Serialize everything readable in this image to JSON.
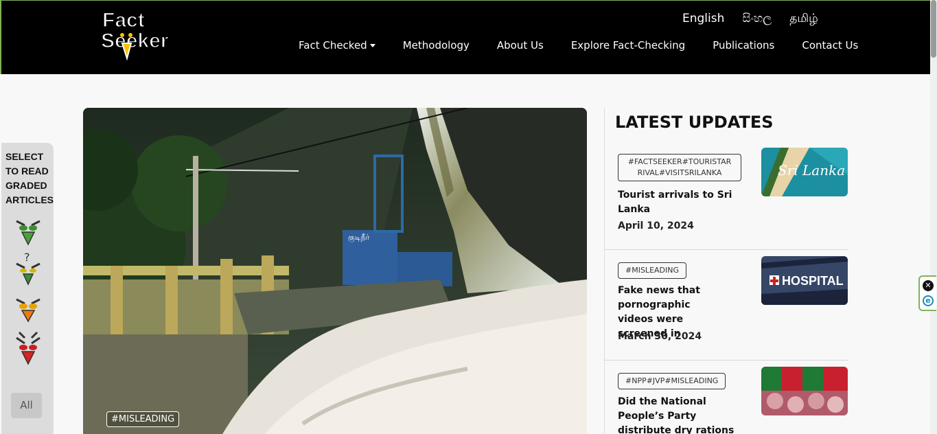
{
  "brand": {
    "logo_line1": "Fact",
    "logo_line2": "Seeker"
  },
  "languages": [
    "English",
    "සිංහල",
    "தமிழ்"
  ],
  "nav": {
    "fact_checked": "Fact Checked",
    "methodology": "Methodology",
    "about_us": "About Us",
    "explore": "Explore Fact-Checking",
    "publications": "Publications",
    "contact_us": "Contact Us"
  },
  "grade_panel": {
    "title_lines": [
      "SELECT",
      "TO READ",
      "GRADED",
      "ARTICLES"
    ],
    "owls": [
      "owl-true-icon",
      "owl-unverified-icon",
      "owl-misleading-icon",
      "owl-false-icon"
    ],
    "all_label": "All"
  },
  "hero": {
    "tag": "#MISLEADING",
    "sign_text": "குடிநீர்"
  },
  "latest": {
    "title": "LATEST UPDATES",
    "items": [
      {
        "tag_line1": "#FACTSEEKER#TOURISTAR",
        "tag_line2": "RIVAL#VISITSRILANKA",
        "headline": "Tourist arrivals to Sri Lanka",
        "date": "April 10, 2024",
        "thumb_text": "Sri Lanka"
      },
      {
        "tag_line1": "#MISLEADING",
        "headline": "Fake news that pornographic videos were screened in",
        "date": "March 30, 2024",
        "thumb_text": "HOSPITAL"
      },
      {
        "tag_line1": "#NPP#JVP#MISLEADING",
        "headline": "Did the National People’s Party distribute dry rations again?"
      }
    ]
  },
  "widget": {
    "close": "✕",
    "e": "e"
  },
  "colors": {
    "header_bg": "#000000",
    "accent_green": "#7fb25a",
    "panel_bg": "#dcdcdc"
  }
}
